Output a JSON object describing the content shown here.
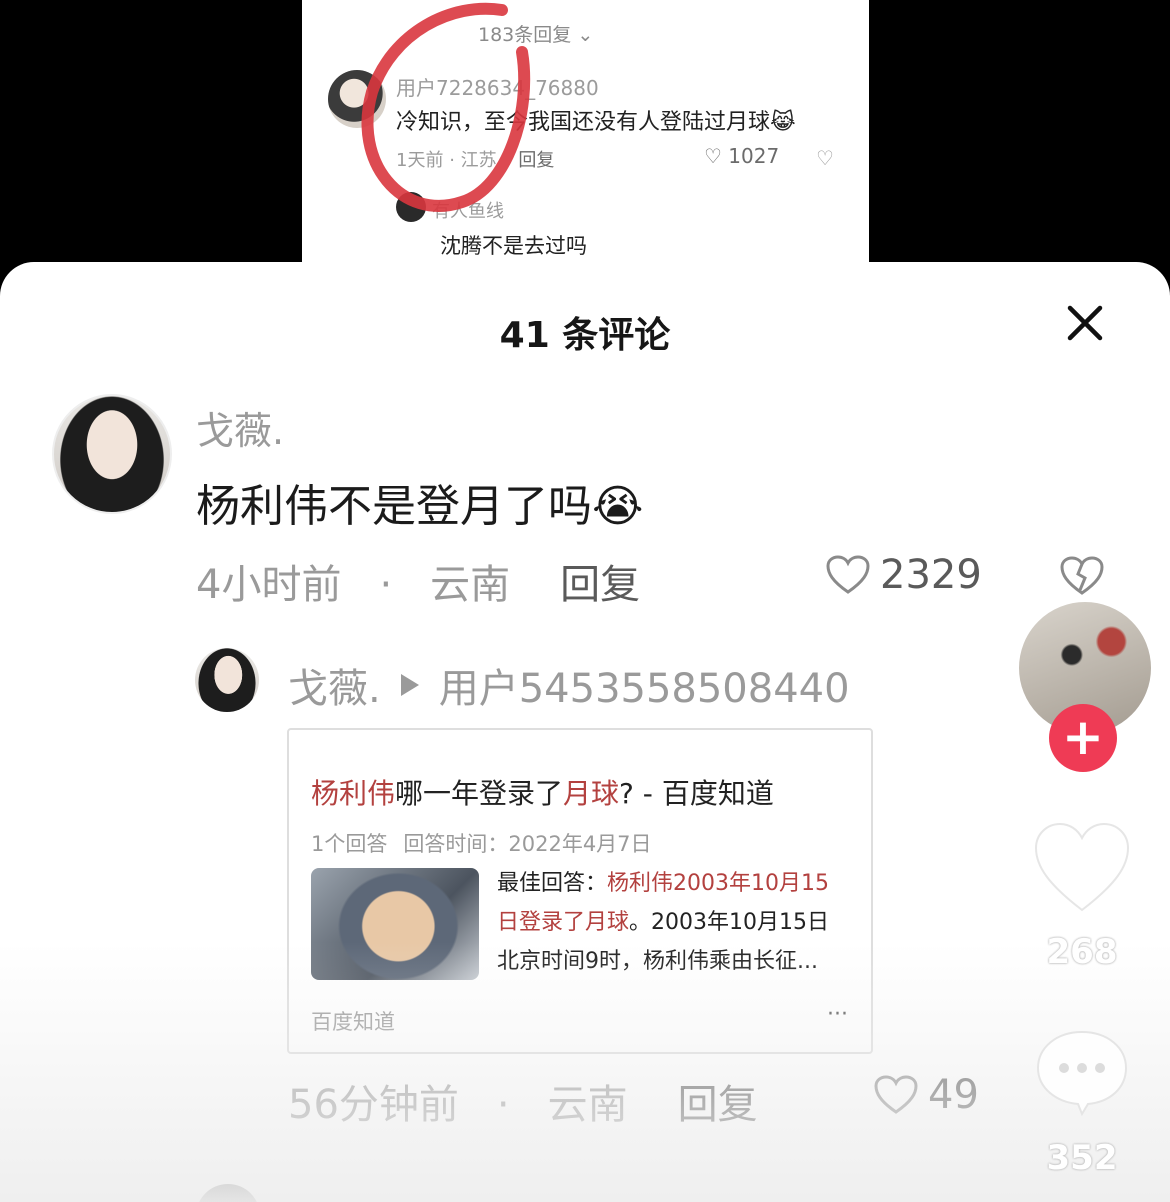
{
  "embedded_screenshot": {
    "replies_count": "183条回复",
    "username": "用户7228634_76880",
    "comment": "冷知识，至今我国还没有人登陆过月球😹",
    "time": "1天前",
    "location": "江苏",
    "reply_label": "回复",
    "likes": "1027",
    "sub_reply_user": "有人鱼线",
    "sub_reply_text": "沈腾不是去过吗"
  },
  "sheet": {
    "title": "41  条评论"
  },
  "comment": {
    "username": "戈薇.",
    "text": "杨利伟不是登月了吗😭",
    "time": "4小时前",
    "location": "云南",
    "reply_label": "回复",
    "likes": "2329"
  },
  "reply": {
    "from": "戈薇.",
    "to": "用户5453558508440",
    "card": {
      "title_parts": [
        "杨利伟",
        "哪一年登录了",
        "月球",
        "? - 百度知道"
      ],
      "answers": "1个回答",
      "answer_time": "回答时间：2022年4月7日",
      "desc_label": "最佳回答：",
      "desc_highlight": "杨利伟2003年10月15日登录了月球",
      "desc_rest": "。2003年10月15日北京时间9时，杨利伟乘由长征...",
      "source": "百度知道",
      "more": "···"
    },
    "time": "56分钟前",
    "location": "云南",
    "reply_label": "回复",
    "likes": "49"
  },
  "side": {
    "follow_symbol": "+",
    "likes": "268",
    "comments": "352"
  },
  "colors": {
    "highlight_red": "#b3413f",
    "follow_red": "#ef3b55"
  }
}
